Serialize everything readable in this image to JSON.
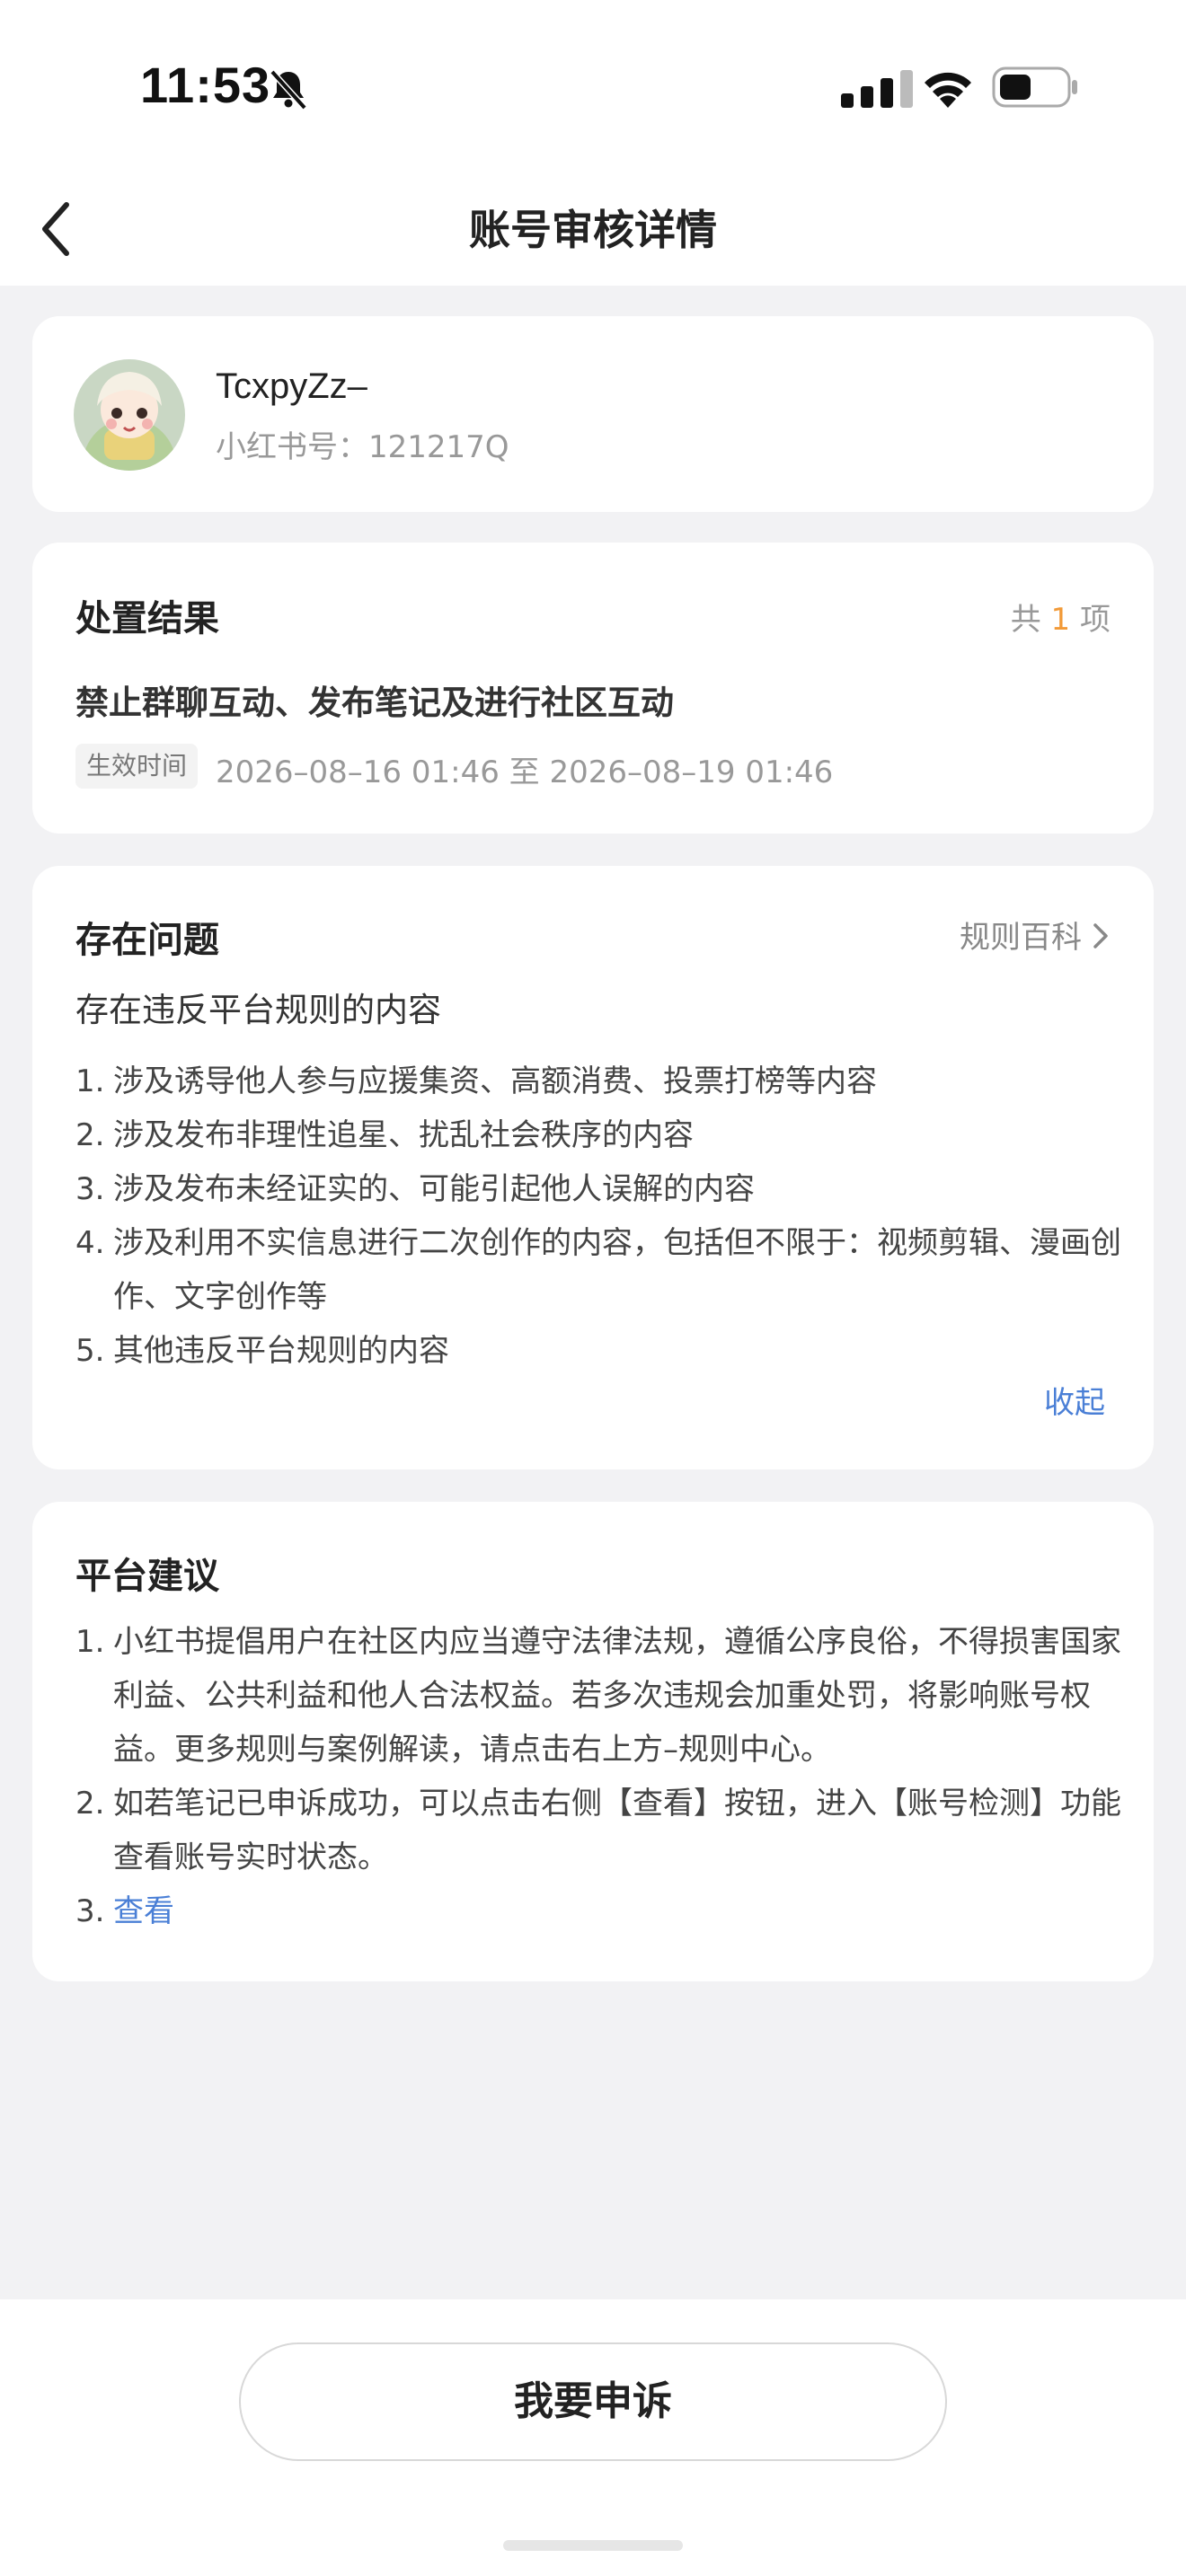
{
  "status_bar": {
    "time": "11:53"
  },
  "nav": {
    "title": "账号审核详情"
  },
  "user": {
    "name": "TcxpyZz–",
    "id_text": "小红书号：121217Q"
  },
  "result": {
    "title": "处置结果",
    "count_prefix": "共",
    "count": "1",
    "count_suffix": "项",
    "item": "禁止群聊互动、发布笔记及进行社区互动",
    "tag": "生效时间",
    "period": "2026–08–16 01:46 至 2026–08–19 01:46"
  },
  "issue": {
    "title": "存在问题",
    "rules_link": "规则百科",
    "subtitle": "存在违反平台规则的内容",
    "items": [
      {
        "n": "1.",
        "text": "涉及诱导他人参与应援集资、高额消费、投票打榜等内容"
      },
      {
        "n": "2.",
        "text": "涉及发布非理性追星、扰乱社会秩序的内容"
      },
      {
        "n": "3.",
        "text": "涉及发布未经证实的、可能引起他人误解的内容"
      },
      {
        "n": "4.",
        "text": "涉及利用不实信息进行二次创作的内容，包括但不限于：视频剪辑、漫画创作、文字创作等"
      },
      {
        "n": "5.",
        "text": "其他违反平台规则的内容"
      }
    ],
    "collapse": "收起"
  },
  "advice": {
    "title": "平台建议",
    "items": [
      {
        "n": "1.",
        "text": "小红书提倡用户在社区内应当遵守法律法规，遵循公序良俗，不得损害国家利益、公共利益和他人合法权益。若多次违规会加重处罚，将影响账号权益。更多规则与案例解读，请点击右上方–规则中心。"
      },
      {
        "n": "2.",
        "text": "如若笔记已申诉成功，可以点击右侧【查看】按钮，进入【账号检测】功能查看账号实时状态。"
      },
      {
        "n": "3.",
        "text": "查看"
      }
    ]
  },
  "footer": {
    "appeal_button": "我要申诉"
  },
  "colors": {
    "accent_blue": "#4a7fd6",
    "count_orange": "#f29a38",
    "background": "#f2f2f4"
  }
}
